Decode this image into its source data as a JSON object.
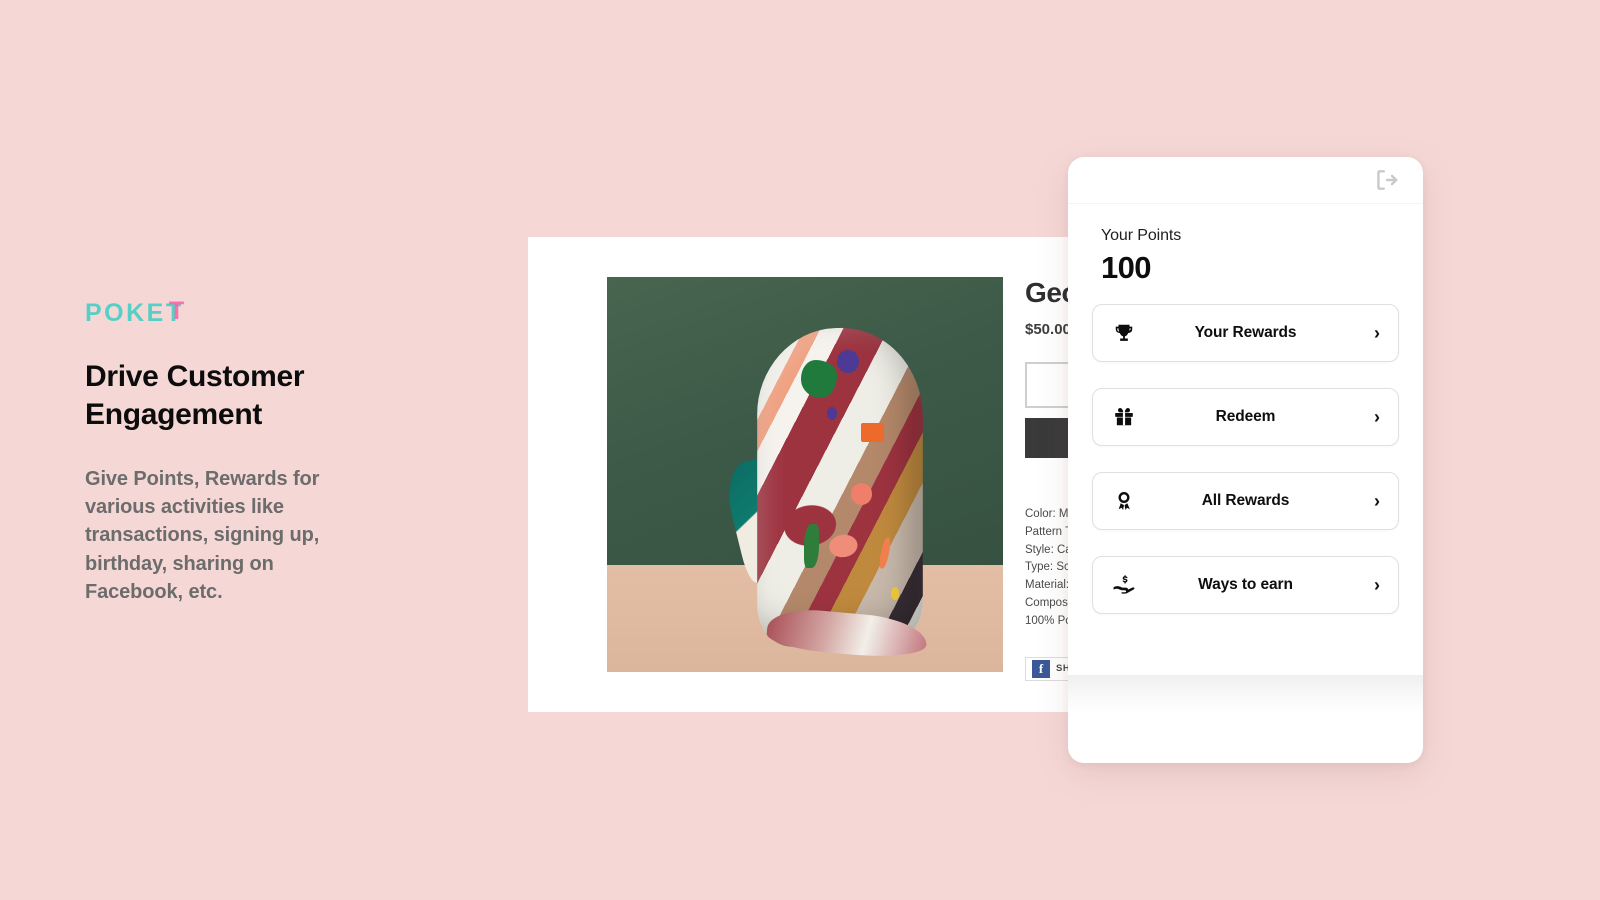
{
  "background_color": "#F5D8D6",
  "brand": {
    "logo_text": "POKE",
    "logo_accent_letter": "T",
    "logo_color": "#56CFC6",
    "logo_accent_color": "#FF5FA2"
  },
  "marketing": {
    "headline": "Drive Customer Engagement",
    "subcopy": "Give Points, Rewards for various activities like transactions, signing up, birthday, sharing on Facebook, etc."
  },
  "product_page": {
    "title": "Geo",
    "price": "$50.00",
    "quantity_value": "",
    "add_to_cart_label": "",
    "details": [
      "Color: M",
      "Pattern T",
      "Style: Ca",
      "Type: Sc",
      "Material:",
      "Composi",
      "100% Po"
    ],
    "share": {
      "icon_glyph": "f",
      "label": "SHA"
    },
    "photo": {
      "wall_color": "#3E5C4B",
      "floor_color": "#E0BA9F",
      "alt": "patterned scarf draped on green background"
    }
  },
  "loyalty_panel": {
    "logout_icon": "logout-icon",
    "points_label": "Your Points",
    "points_value": "100",
    "menu_items": [
      {
        "icon": "trophy-icon",
        "label": "Your Rewards",
        "chevron": "›"
      },
      {
        "icon": "gift-icon",
        "label": "Redeem",
        "chevron": "›"
      },
      {
        "icon": "award-icon",
        "label": "All Rewards",
        "chevron": "›"
      },
      {
        "icon": "hand-money-icon",
        "label": "Ways to earn",
        "chevron": "›"
      }
    ]
  }
}
